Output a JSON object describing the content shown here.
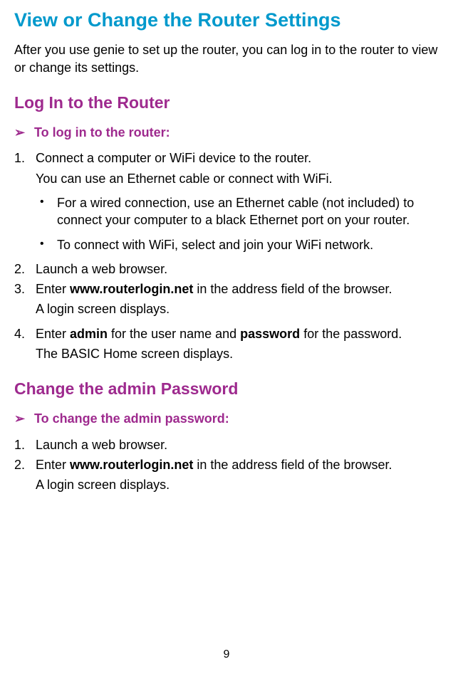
{
  "h1": "View or Change the Router Settings",
  "intro": "After you use genie to set up the router, you can log in to the router to view or change its settings.",
  "section1": {
    "heading": "Log In to the Router",
    "task": "To log in to the router:",
    "steps": {
      "s1_main": "Connect a computer or WiFi device to the router.",
      "s1_sub": "You can use an Ethernet cable or connect with WiFi.",
      "s1_bullets": {
        "b1": "For a wired connection, use an Ethernet cable (not included) to connect your computer to a black Ethernet port on your router.",
        "b2": "To connect with WiFi, select and join your WiFi network."
      },
      "s2_main": "Launch a web browser.",
      "s3_pre": "Enter ",
      "s3_bold": "www.routerlogin.net",
      "s3_post": " in the address field of the browser.",
      "s3_sub": "A login screen displays.",
      "s4_pre": "Enter ",
      "s4_bold1": "admin",
      "s4_mid": " for the user name and ",
      "s4_bold2": "password",
      "s4_post": " for the password.",
      "s4_sub": "The BASIC Home screen displays."
    }
  },
  "section2": {
    "heading": "Change the admin Password",
    "task": "To change the admin password:",
    "steps": {
      "s1_main": "Launch a web browser.",
      "s2_pre": "Enter ",
      "s2_bold": "www.routerlogin.net",
      "s2_post": " in the address field of the browser.",
      "s2_sub": "A login screen displays."
    }
  },
  "pageNumber": "9",
  "arrow": "➢"
}
